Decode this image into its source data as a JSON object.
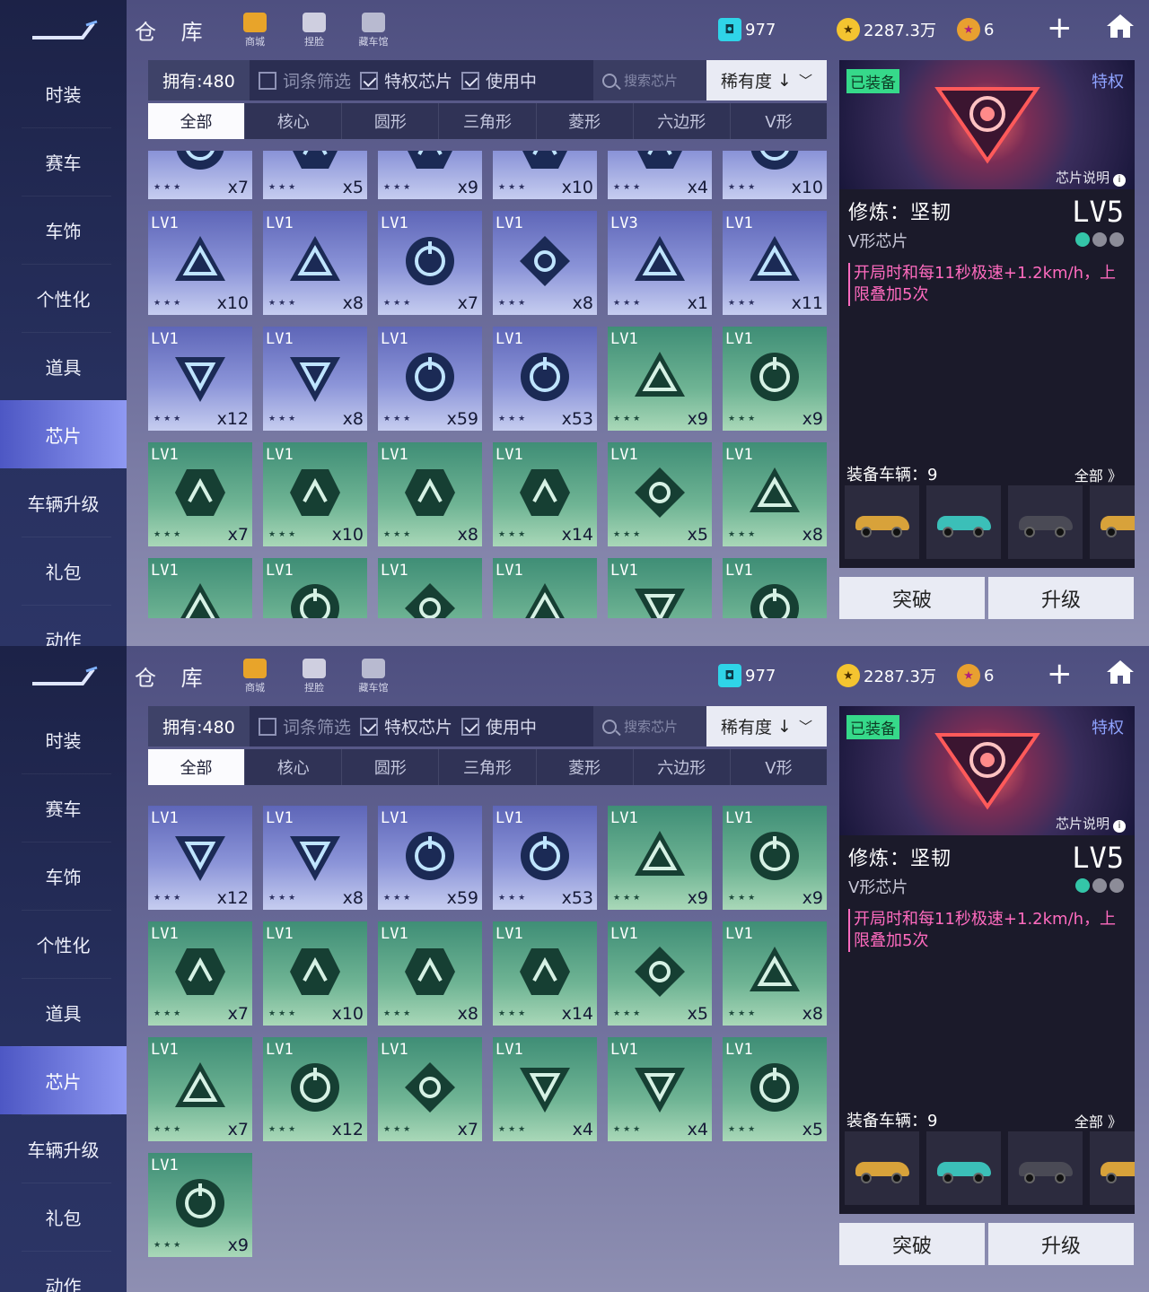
{
  "screens": [
    {
      "sidebar": [
        "时装",
        "赛车",
        "车饰",
        "个性化",
        "道具",
        "芯片",
        "车辆升级",
        "礼包",
        "动作"
      ],
      "active_sidebar": 5,
      "title": "仓 库",
      "top_icons": [
        "商城",
        "捏脸",
        "藏车馆"
      ],
      "currency": {
        "ticket": "977",
        "coins": "2287.3万",
        "stars": "6"
      },
      "filter": {
        "owned": "拥有:480",
        "c1": "词条筛选",
        "c2": "特权芯片",
        "c3": "使用中",
        "search_placeholder": "搜索芯片",
        "sort": "稀有度"
      },
      "tabs": [
        "全部",
        "核心",
        "圆形",
        "三角形",
        "菱形",
        "六边形",
        "V形"
      ],
      "tiles": [
        {
          "lv": "",
          "qty": "x7",
          "color": "blue",
          "shape": "ring"
        },
        {
          "lv": "",
          "qty": "x5",
          "color": "blue",
          "shape": "hex"
        },
        {
          "lv": "",
          "qty": "x9",
          "color": "blue",
          "shape": "hex"
        },
        {
          "lv": "",
          "qty": "x10",
          "color": "blue",
          "shape": "hex"
        },
        {
          "lv": "",
          "qty": "x4",
          "color": "blue",
          "shape": "hex"
        },
        {
          "lv": "",
          "qty": "x10",
          "color": "blue",
          "shape": "ring"
        },
        {
          "lv": "LV1",
          "qty": "x10",
          "color": "blue",
          "shape": "tri"
        },
        {
          "lv": "LV1",
          "qty": "x8",
          "color": "blue",
          "shape": "tri"
        },
        {
          "lv": "LV1",
          "qty": "x7",
          "color": "blue",
          "shape": "ring"
        },
        {
          "lv": "LV1",
          "qty": "x8",
          "color": "blue",
          "shape": "diamond"
        },
        {
          "lv": "LV3",
          "qty": "x1",
          "color": "blue",
          "shape": "tri"
        },
        {
          "lv": "LV1",
          "qty": "x11",
          "color": "blue",
          "shape": "tri"
        },
        {
          "lv": "LV1",
          "qty": "x12",
          "color": "blue",
          "shape": "vtri"
        },
        {
          "lv": "LV1",
          "qty": "x8",
          "color": "blue",
          "shape": "vtri"
        },
        {
          "lv": "LV1",
          "qty": "x59",
          "color": "blue",
          "shape": "ring"
        },
        {
          "lv": "LV1",
          "qty": "x53",
          "color": "blue",
          "shape": "ring"
        },
        {
          "lv": "LV1",
          "qty": "x9",
          "color": "green",
          "shape": "tri"
        },
        {
          "lv": "LV1",
          "qty": "x9",
          "color": "green",
          "shape": "ring"
        },
        {
          "lv": "LV1",
          "qty": "x7",
          "color": "green",
          "shape": "hex"
        },
        {
          "lv": "LV1",
          "qty": "x10",
          "color": "green",
          "shape": "hex"
        },
        {
          "lv": "LV1",
          "qty": "x8",
          "color": "green",
          "shape": "hex"
        },
        {
          "lv": "LV1",
          "qty": "x14",
          "color": "green",
          "shape": "hex"
        },
        {
          "lv": "LV1",
          "qty": "x5",
          "color": "green",
          "shape": "diamond"
        },
        {
          "lv": "LV1",
          "qty": "x8",
          "color": "green",
          "shape": "tri"
        },
        {
          "lv": "LV1",
          "qty": "",
          "color": "green",
          "shape": "tri"
        },
        {
          "lv": "LV1",
          "qty": "",
          "color": "green",
          "shape": "ring"
        },
        {
          "lv": "LV1",
          "qty": "",
          "color": "green",
          "shape": "diamond"
        },
        {
          "lv": "LV1",
          "qty": "",
          "color": "green",
          "shape": "tri"
        },
        {
          "lv": "LV1",
          "qty": "",
          "color": "green",
          "shape": "vtri"
        },
        {
          "lv": "LV1",
          "qty": "",
          "color": "green",
          "shape": "ring"
        }
      ],
      "panel": {
        "equipped": "已装备",
        "privilege": "特权",
        "chip_desc": "芯片说明",
        "name": "修炼：坚韧",
        "level": "LV5",
        "type": "V形芯片",
        "effect": "开局时和每11秒极速+1.2km/h，上限叠加5次",
        "vehicles": "装备车辆：9",
        "all": "全部 》",
        "cars": [
          "#d8a23a",
          "#3bbfb8",
          "#4a4a55",
          "#d8a23a"
        ],
        "btn_break": "突破",
        "btn_up": "升级"
      }
    },
    {
      "sidebar": [
        "时装",
        "赛车",
        "车饰",
        "个性化",
        "道具",
        "芯片",
        "车辆升级",
        "礼包",
        "动作"
      ],
      "active_sidebar": 5,
      "title": "仓 库",
      "top_icons": [
        "商城",
        "捏脸",
        "藏车馆"
      ],
      "currency": {
        "ticket": "977",
        "coins": "2287.3万",
        "stars": "6"
      },
      "filter": {
        "owned": "拥有:480",
        "c1": "词条筛选",
        "c2": "特权芯片",
        "c3": "使用中",
        "search_placeholder": "搜索芯片",
        "sort": "稀有度"
      },
      "tabs": [
        "全部",
        "核心",
        "圆形",
        "三角形",
        "菱形",
        "六边形",
        "V形"
      ],
      "tiles": [
        {
          "lv": "LV1",
          "qty": "x12",
          "color": "blue",
          "shape": "vtri"
        },
        {
          "lv": "LV1",
          "qty": "x8",
          "color": "blue",
          "shape": "vtri"
        },
        {
          "lv": "LV1",
          "qty": "x59",
          "color": "blue",
          "shape": "ring"
        },
        {
          "lv": "LV1",
          "qty": "x53",
          "color": "blue",
          "shape": "ring"
        },
        {
          "lv": "LV1",
          "qty": "x9",
          "color": "green",
          "shape": "tri"
        },
        {
          "lv": "LV1",
          "qty": "x9",
          "color": "green",
          "shape": "ring"
        },
        {
          "lv": "LV1",
          "qty": "x7",
          "color": "green",
          "shape": "hex"
        },
        {
          "lv": "LV1",
          "qty": "x10",
          "color": "green",
          "shape": "hex"
        },
        {
          "lv": "LV1",
          "qty": "x8",
          "color": "green",
          "shape": "hex"
        },
        {
          "lv": "LV1",
          "qty": "x14",
          "color": "green",
          "shape": "hex"
        },
        {
          "lv": "LV1",
          "qty": "x5",
          "color": "green",
          "shape": "diamond"
        },
        {
          "lv": "LV1",
          "qty": "x8",
          "color": "green",
          "shape": "tri"
        },
        {
          "lv": "LV1",
          "qty": "x7",
          "color": "green",
          "shape": "tri"
        },
        {
          "lv": "LV1",
          "qty": "x12",
          "color": "green",
          "shape": "ring"
        },
        {
          "lv": "LV1",
          "qty": "x7",
          "color": "green",
          "shape": "diamond"
        },
        {
          "lv": "LV1",
          "qty": "x4",
          "color": "green",
          "shape": "vtri"
        },
        {
          "lv": "LV1",
          "qty": "x4",
          "color": "green",
          "shape": "vtri"
        },
        {
          "lv": "LV1",
          "qty": "x5",
          "color": "green",
          "shape": "ring"
        },
        {
          "lv": "LV1",
          "qty": "x9",
          "color": "green",
          "shape": "ring"
        }
      ],
      "panel": {
        "equipped": "已装备",
        "privilege": "特权",
        "chip_desc": "芯片说明",
        "name": "修炼：坚韧",
        "level": "LV5",
        "type": "V形芯片",
        "effect": "开局时和每11秒极速+1.2km/h，上限叠加5次",
        "vehicles": "装备车辆：9",
        "all": "全部 》",
        "cars": [
          "#d8a23a",
          "#3bbfb8",
          "#4a4a55",
          "#d8a23a"
        ],
        "btn_break": "突破",
        "btn_up": "升级"
      }
    }
  ]
}
